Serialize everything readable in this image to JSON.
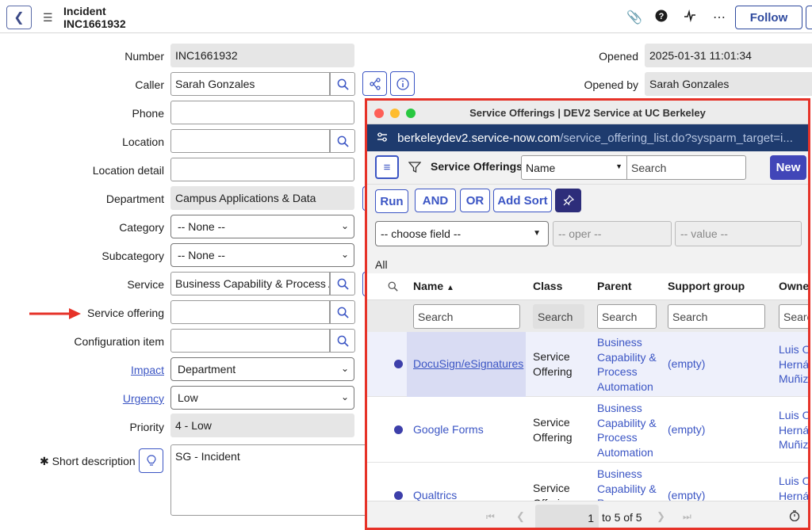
{
  "header": {
    "title": "Incident",
    "number": "INC1661932",
    "follow_label": "Follow"
  },
  "form": {
    "number_label": "Number",
    "number_value": "INC1661932",
    "caller_label": "Caller",
    "caller_value": "Sarah Gonzales",
    "phone_label": "Phone",
    "location_label": "Location",
    "location_detail_label": "Location detail",
    "department_label": "Department",
    "department_value": "Campus Applications & Data",
    "category_label": "Category",
    "category_value": "-- None --",
    "subcategory_label": "Subcategory",
    "subcategory_value": "-- None --",
    "service_label": "Service",
    "service_value": "Business Capability & Process Automation",
    "service_offering_label": "Service offering",
    "config_item_label": "Configuration item",
    "impact_label": "Impact",
    "impact_value": "Department",
    "urgency_label": "Urgency",
    "urgency_value": "Low",
    "priority_label": "Priority",
    "priority_value": "4 - Low",
    "short_desc_label": "Short description",
    "short_desc_value": "SG - Incident",
    "opened_label": "Opened",
    "opened_value": "2025-01-31 11:01:34",
    "opened_by_label": "Opened by",
    "opened_by_value": "Sarah Gonzales"
  },
  "popup": {
    "window_title": "Service Offerings | DEV2 Service at UC Berkeley",
    "url_host": "berkeleydev2.service-now.com",
    "url_path": "/service_offering_list.do?sysparm_target=i...",
    "list_title": "Service Offerings",
    "search_field_value": "Name",
    "search_placeholder": "Search",
    "new_label": "New",
    "run_label": "Run",
    "and_label": "AND",
    "or_label": "OR",
    "add_sort_label": "Add Sort",
    "choose_field": "-- choose field --",
    "oper": "-- oper --",
    "value": "-- value --",
    "breadcrumb_all": "All",
    "columns": [
      "Name",
      "Class",
      "Parent",
      "Support group",
      "Owner"
    ],
    "column_search_placeholders": [
      "Search",
      "Search",
      "Search",
      "Search",
      "Searc"
    ],
    "rows": [
      {
        "name": "DocuSign/eSignatures",
        "class": "Service Offering",
        "parent": "Business Capability & Process Automation",
        "support_group": "(empty)",
        "owner": "Luis O Hernández Muñiz"
      },
      {
        "name": "Google Forms",
        "class": "Service Offering",
        "parent": "Business Capability & Process Automation",
        "support_group": "(empty)",
        "owner": "Luis O Hernández Muñiz"
      },
      {
        "name": "Qualtrics",
        "class": "Service Offering",
        "parent": "Business Capability & Process Automation",
        "support_group": "(empty)",
        "owner": "Luis O Hernández Muñiz"
      }
    ],
    "pager": {
      "current": "1",
      "range_text": "to 5 of 5"
    }
  },
  "colors": {
    "accent": "#3b55c4",
    "highlight_red": "#e63228",
    "url_bar": "#1e3b6e"
  }
}
